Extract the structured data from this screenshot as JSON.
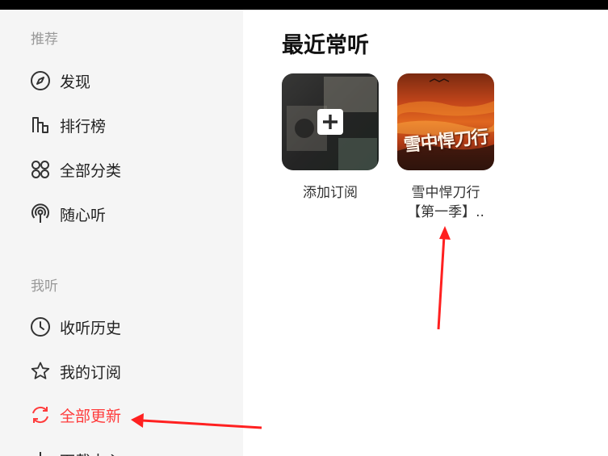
{
  "sidebar": {
    "recommend_title": "推荐",
    "recommend_items": [
      {
        "label": "发现",
        "icon": "compass-icon"
      },
      {
        "label": "排行榜",
        "icon": "bar-chart-icon"
      },
      {
        "label": "全部分类",
        "icon": "grid-icon"
      },
      {
        "label": "随心听",
        "icon": "broadcast-icon"
      }
    ],
    "mine_title": "我听",
    "mine_items": [
      {
        "label": "收听历史",
        "icon": "clock-icon"
      },
      {
        "label": "我的订阅",
        "icon": "star-icon"
      },
      {
        "label": "全部更新",
        "icon": "refresh-icon",
        "active": true
      },
      {
        "label": "下载中心",
        "icon": "download-icon"
      }
    ]
  },
  "main": {
    "title": "最近常听",
    "cards": [
      {
        "label": "添加订阅",
        "icon": "plus-square-icon"
      },
      {
        "label_line1": "雪中悍刀行",
        "label_line2": "【第一季】..",
        "cover_text": "雪中悍刀行"
      }
    ]
  },
  "colors": {
    "accent": "#ff3b3b",
    "sidebar_bg": "#f5f5f5",
    "annotation_arrow": "#ff2020"
  }
}
